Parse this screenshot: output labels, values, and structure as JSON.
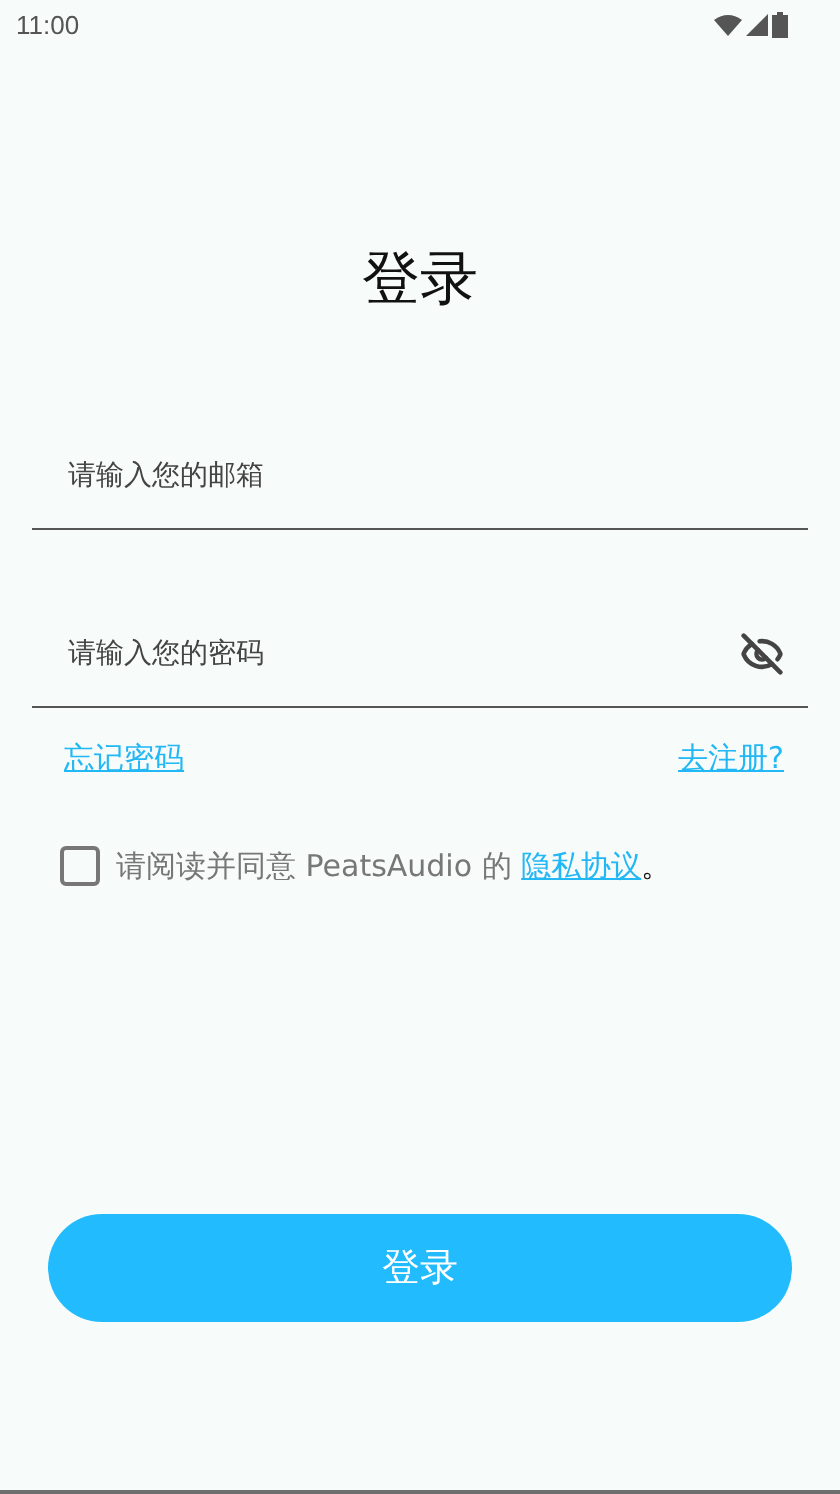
{
  "status_bar": {
    "time": "11:00"
  },
  "title": "登录",
  "email_field": {
    "placeholder": "请输入您的邮箱"
  },
  "password_field": {
    "placeholder": "请输入您的密码",
    "password_visible": false
  },
  "links": {
    "forgot": "忘记密码",
    "register": "去注册?"
  },
  "agreement": {
    "checked": false,
    "text": "请阅读并同意 PeatsAudio 的 ",
    "link": "隐私协议",
    "suffix": "。"
  },
  "login_button": "登录"
}
